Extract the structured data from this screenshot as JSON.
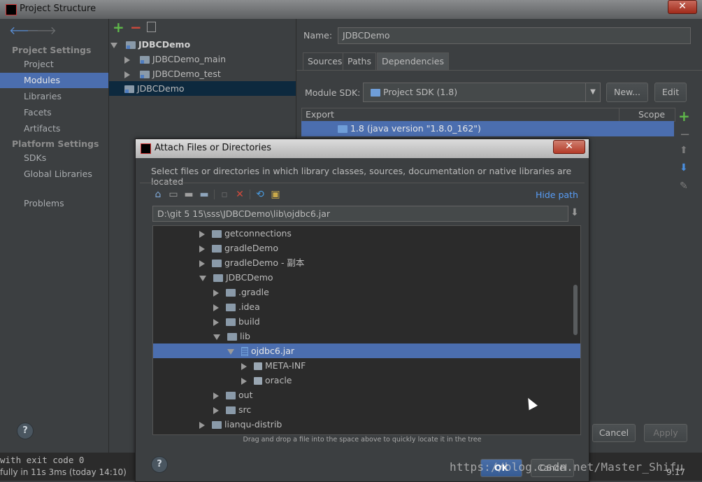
{
  "window": {
    "title": "Project Structure",
    "close_label": "✕"
  },
  "sidebar": {
    "project_settings_title": "Project Settings",
    "project_settings_items": [
      "Project",
      "Modules",
      "Libraries",
      "Facets",
      "Artifacts"
    ],
    "platform_settings_title": "Platform Settings",
    "platform_settings_items": [
      "SDKs",
      "Global Libraries"
    ],
    "problems": "Problems",
    "selected": "Modules"
  },
  "module_tree": {
    "root": "JDBCDemo",
    "children": [
      "JDBCDemo_main",
      "JDBCDemo_test"
    ],
    "second_root": "JDBCDemo"
  },
  "module_panel": {
    "name_label": "Name:",
    "name_value": "JDBCDemo",
    "tabs": [
      "Sources",
      "Paths",
      "Dependencies"
    ],
    "active_tab": "Dependencies",
    "sdk_label": "Module SDK:",
    "sdk_value": "Project SDK (1.8)",
    "new_button": "New...",
    "edit_button": "Edit",
    "columns": {
      "export": "Export",
      "scope": "Scope"
    },
    "dependency_row": "1.8 (java version \"1.8.0_162\")",
    "cancel_button": "Cancel",
    "apply_button": "Apply"
  },
  "dialog": {
    "title": "Attach Files or Directories",
    "close_label": "✕",
    "description": "Select files or directories in which library classes, sources, documentation or native libraries are located",
    "hide_path": "Hide path",
    "path": "D:\\git 5 15\\sss\\JDBCDemo\\lib\\ojdbc6.jar",
    "tree": [
      {
        "label": "getconnections",
        "indent": 0,
        "kind": "folder",
        "expand": "collapsed"
      },
      {
        "label": "gradleDemo",
        "indent": 0,
        "kind": "folder",
        "expand": "collapsed"
      },
      {
        "label": "gradleDemo - 副本",
        "indent": 0,
        "kind": "folder",
        "expand": "collapsed"
      },
      {
        "label": "JDBCDemo",
        "indent": 0,
        "kind": "folder",
        "expand": "expanded"
      },
      {
        "label": ".gradle",
        "indent": 1,
        "kind": "folder",
        "expand": "collapsed"
      },
      {
        "label": ".idea",
        "indent": 1,
        "kind": "folder",
        "expand": "collapsed"
      },
      {
        "label": "build",
        "indent": 1,
        "kind": "folder",
        "expand": "collapsed"
      },
      {
        "label": "lib",
        "indent": 1,
        "kind": "folder",
        "expand": "expanded"
      },
      {
        "label": "ojdbc6.jar",
        "indent": 2,
        "kind": "jar",
        "expand": "expanded",
        "selected": true
      },
      {
        "label": "META-INF",
        "indent": 3,
        "kind": "pkg",
        "expand": "collapsed"
      },
      {
        "label": "oracle",
        "indent": 3,
        "kind": "pkg",
        "expand": "collapsed"
      },
      {
        "label": "out",
        "indent": 1,
        "kind": "folder",
        "expand": "collapsed"
      },
      {
        "label": "src",
        "indent": 1,
        "kind": "folder",
        "expand": "collapsed"
      },
      {
        "label": "lianqu-distrib",
        "indent": 0,
        "kind": "folder",
        "expand": "collapsed"
      }
    ],
    "drag_hint": "Drag and drop a file into the space above to quickly locate it in the tree",
    "ok_button": "OK",
    "cancel_button": "Cancel",
    "help": "?"
  },
  "status": {
    "line1": "with exit code 0",
    "line2": "fully in 11s 3ms (today 14:10)",
    "watermark": "https://blog.csdn.net/Master_Shifu",
    "clock": "9:17"
  },
  "help_label": "?",
  "colors": {
    "selection": "#4b6eaf",
    "background": "#3c3f41",
    "link": "#589df6"
  }
}
